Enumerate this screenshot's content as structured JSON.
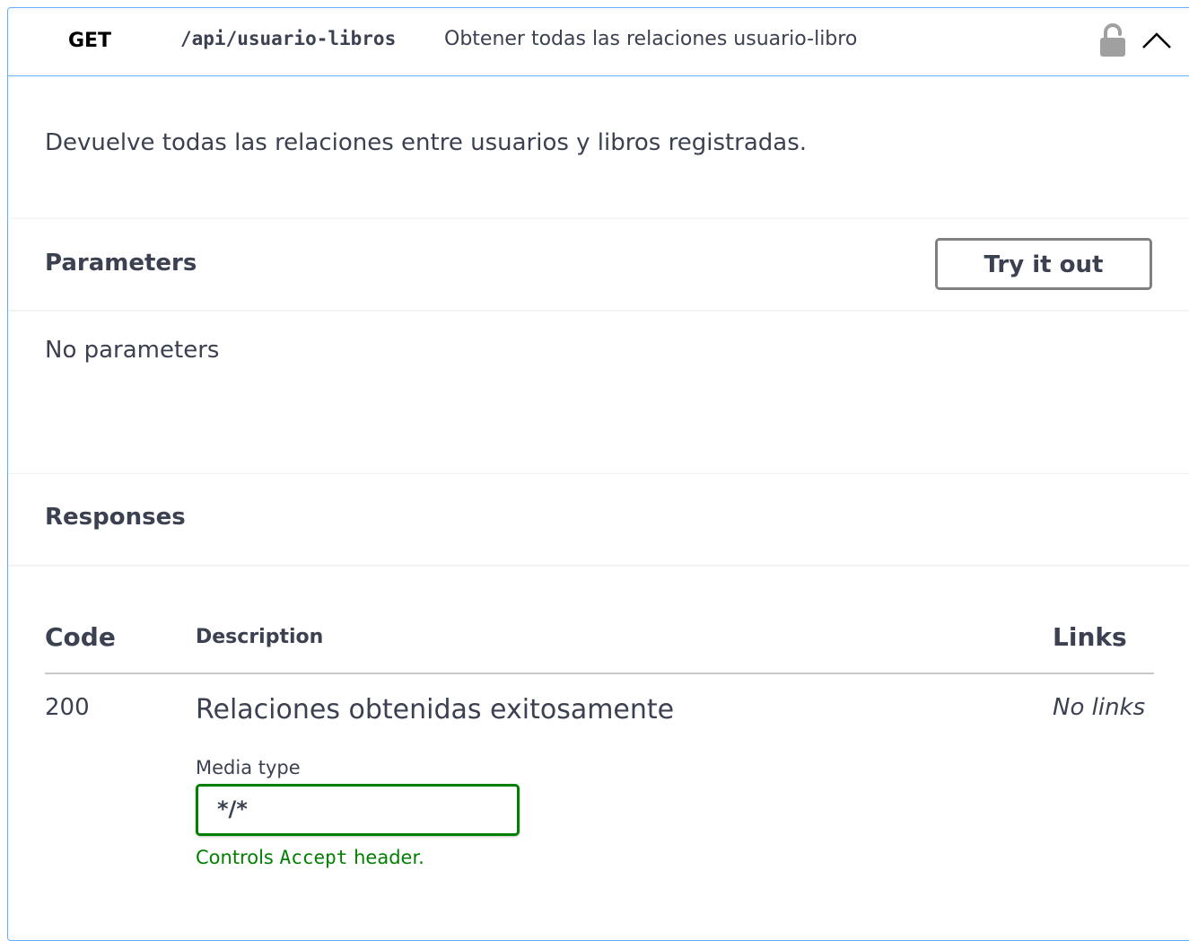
{
  "operation": {
    "method": "GET",
    "path": "/api/usuario-libros",
    "summary": "Obtener todas las relaciones usuario-libro",
    "description": "Devuelve todas las relaciones entre usuarios y libros registradas.",
    "lock_icon": "unlocked-lock-icon",
    "collapse_icon": "chevron-up-icon"
  },
  "parameters": {
    "title": "Parameters",
    "try_label": "Try it out",
    "empty_text": "No parameters"
  },
  "responses": {
    "title": "Responses",
    "columns": {
      "code": "Code",
      "description": "Description",
      "links": "Links"
    },
    "rows": [
      {
        "code": "200",
        "description": "Relaciones obtenidas exitosamente",
        "links": "No links",
        "media_type_label": "Media type",
        "media_type_value": "*/*",
        "hint_prefix": "Controls",
        "hint_code": "Accept",
        "hint_suffix": "header."
      }
    ]
  },
  "colors": {
    "method_border": "#61affe",
    "media_border": "#008000",
    "hint_text": "#008000"
  }
}
